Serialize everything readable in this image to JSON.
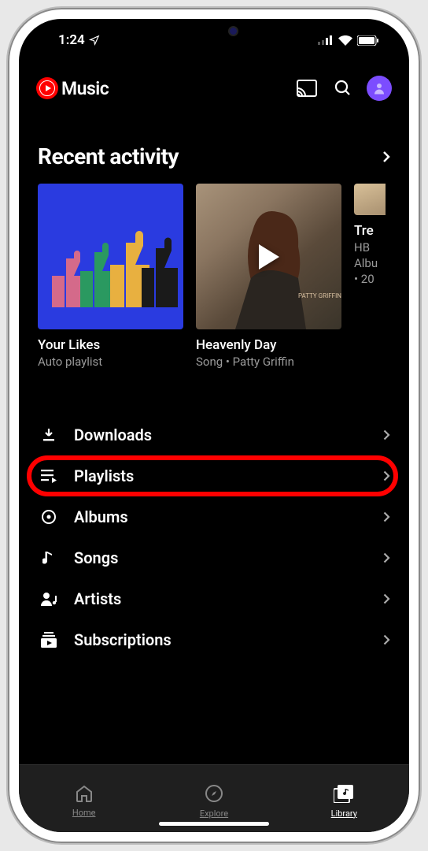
{
  "status": {
    "time": "1:24"
  },
  "brand": {
    "name": "Music"
  },
  "section": {
    "title": "Recent activity"
  },
  "cards": [
    {
      "title": "Your Likes",
      "subtitle": "Auto playlist"
    },
    {
      "title": "Heavenly Day",
      "subtitle": "Song • Patty Griffin"
    },
    {
      "title": "Tre",
      "subtitle1": "HB",
      "subtitle2": "Albu",
      "subtitle3": "• 20"
    }
  ],
  "menu": {
    "downloads": "Downloads",
    "playlists": "Playlists",
    "albums": "Albums",
    "songs": "Songs",
    "artists": "Artists",
    "subscriptions": "Subscriptions"
  },
  "nav": {
    "home": "Home",
    "explore": "Explore",
    "library": "Library"
  }
}
